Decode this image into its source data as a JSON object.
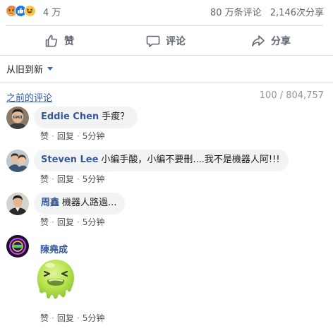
{
  "stats": {
    "reaction_count": "4 万",
    "comment_count": "80 万条评论",
    "share_count": "2,146次分享",
    "reactions": [
      "angry",
      "like",
      "haha"
    ]
  },
  "actions": {
    "like": "赞",
    "comment": "评论",
    "share": "分享"
  },
  "sort": {
    "label": "从旧到新"
  },
  "previous": {
    "link": "之前的评论",
    "count": "100 / 804,757"
  },
  "comments": [
    {
      "author": "Eddie Chen",
      "text": "手痠？",
      "like": "赞",
      "reply": "回复",
      "time": "5分钟"
    },
    {
      "author": "Steven Lee",
      "text": "小編手酸，小編不要刪....我不是機器人阿!!!",
      "like": "赞",
      "reply": "回复",
      "time": "5分钟"
    },
    {
      "author": "周鑫",
      "text": "機器人路過...",
      "like": "赞",
      "reply": "回复",
      "time": "5分钟"
    },
    {
      "author": "陳堯成",
      "text": "",
      "sticker": "vomit-face-sticker",
      "like": "赞",
      "reply": "回复",
      "time": "5分钟"
    }
  ],
  "colors": {
    "link": "#385898",
    "muted": "#606770",
    "bubble": "#f2f3f5",
    "divider": "#dadde1",
    "like_blue": "#1877f2"
  }
}
